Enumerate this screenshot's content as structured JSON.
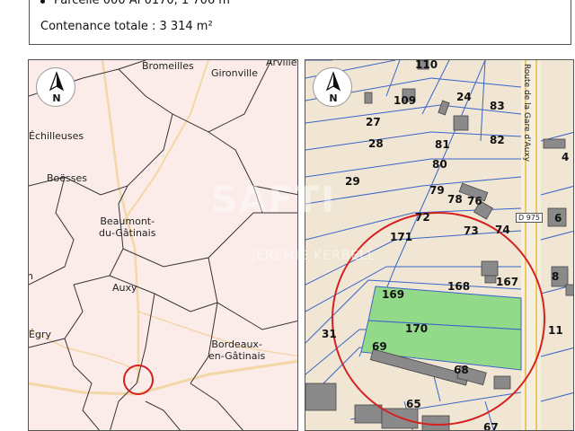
{
  "info": {
    "parcel_line": "Parcelle 000 AI 0170, 1 706 m²",
    "total_line": "Contenance totale : 3 314 m²"
  },
  "compass": {
    "north_label": "N"
  },
  "left_map": {
    "towns": {
      "bromeilles": "Bromeilles",
      "gironville": "Gironville",
      "arville": "Arville",
      "echilleuses": "Échilleuses",
      "boesses": "Boësses",
      "beaumont": "Beaumont-\ndu-Gâtinais",
      "auxy": "Auxy",
      "egry": "Égry",
      "bordeaux": "Bordeaux-\nen-Gâtinais",
      "left_edge_n": "n"
    }
  },
  "right_map": {
    "parcels": {
      "p110": "110",
      "p109": "109",
      "p24": "24",
      "p83": "83",
      "p27": "27",
      "p28": "28",
      "p81": "81",
      "p82": "82",
      "p4": "4",
      "p80": "80",
      "p29": "29",
      "p79": "79",
      "p78": "78",
      "p76": "76",
      "p72": "72",
      "p73": "73",
      "p74": "74",
      "p6": "6",
      "p171": "171",
      "p8": "8",
      "p168": "168",
      "p167": "167",
      "p169": "169",
      "p170": "170",
      "p11": "11",
      "p31": "31",
      "p69": "69",
      "p68": "68",
      "p65": "65",
      "p67": "67"
    },
    "road_name": "Route de la Gare d'Auxy",
    "road_tag": "D 975",
    "highlight_color": "#93d98a"
  },
  "watermark": {
    "brand": "SAFTI",
    "agent": "JEREMIE KERBELL"
  }
}
